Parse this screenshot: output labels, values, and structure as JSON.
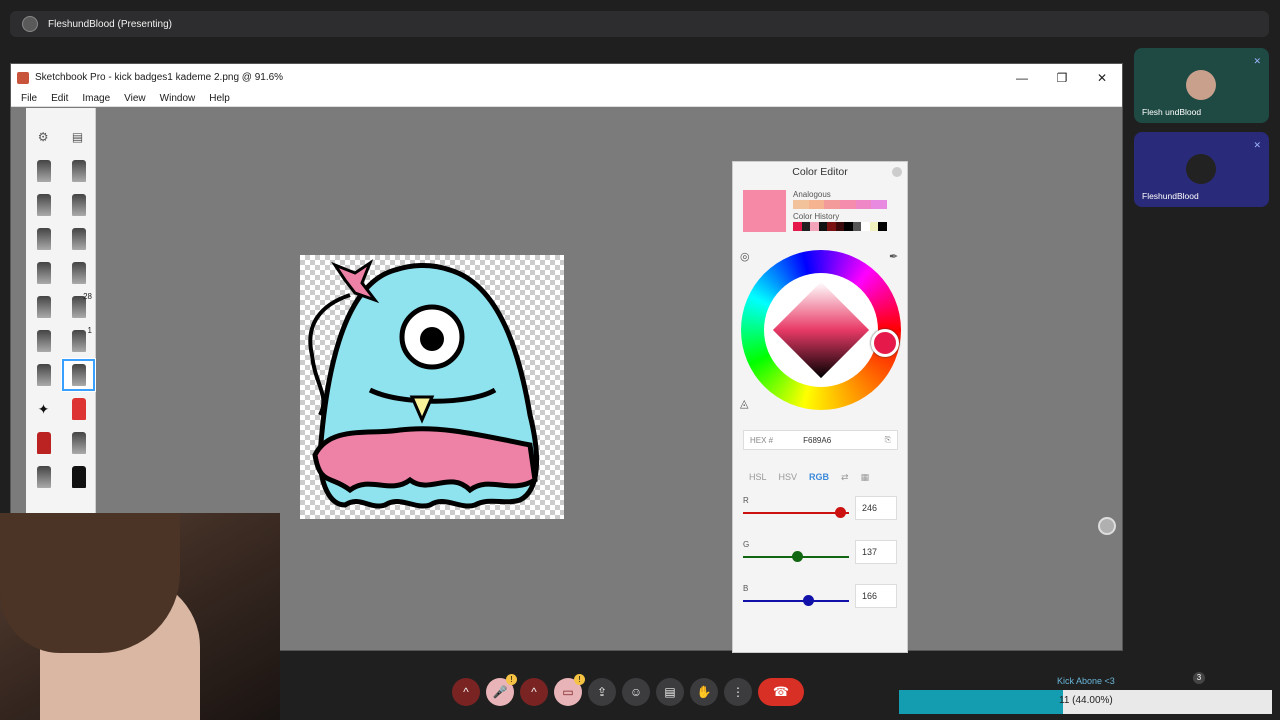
{
  "meet": {
    "title": "FleshundBlood (Presenting)"
  },
  "sketchbook": {
    "title": "Sketchbook Pro - kick badges1 kademe 2.png @ 91.6%",
    "window_controls": [
      "—",
      "❐",
      "✕"
    ],
    "menu": [
      "File",
      "Edit",
      "Image",
      "View",
      "Window",
      "Help"
    ],
    "tool_numbers": {
      "t1": "28",
      "t2": "1"
    }
  },
  "color_editor": {
    "title": "Color Editor",
    "current_color": "#F689A6",
    "analogous_label": "Analogous",
    "analogous_colors": [
      "#f2c29a",
      "#f5b38f",
      "#f39a9b",
      "#f58cad",
      "#ef86c6",
      "#e88ae0"
    ],
    "history_label": "Color History",
    "history_colors": [
      "#e6194b",
      "#222222",
      "#f4a4b8",
      "#111111",
      "#7a1212",
      "#3a0a0a",
      "#000000",
      "#555555",
      "#ffffff",
      "#f2f2c0",
      "#000000"
    ],
    "hex_label": "HEX #",
    "hex_value": "F689A6",
    "tabs": [
      "HSL",
      "HSV",
      "RGB"
    ],
    "active_tab": "RGB",
    "channels": [
      {
        "name": "R",
        "value": "246",
        "fraction": 0.965,
        "color": "#cc1111"
      },
      {
        "name": "G",
        "value": "137",
        "fraction": 0.537,
        "color": "#116611"
      },
      {
        "name": "B",
        "value": "166",
        "fraction": 0.651,
        "color": "#1111aa"
      }
    ]
  },
  "participants": [
    {
      "name": "Flesh undBlood",
      "bg": "#1f4a44"
    },
    {
      "name": "FleshundBlood",
      "bg": "#2a2a7a"
    }
  ],
  "controls": {
    "warn_badge": "!"
  },
  "goal": {
    "label": "Kick Abone <3",
    "text": "11 (44.00%)",
    "progress": 0.44,
    "count_badge": "3"
  }
}
